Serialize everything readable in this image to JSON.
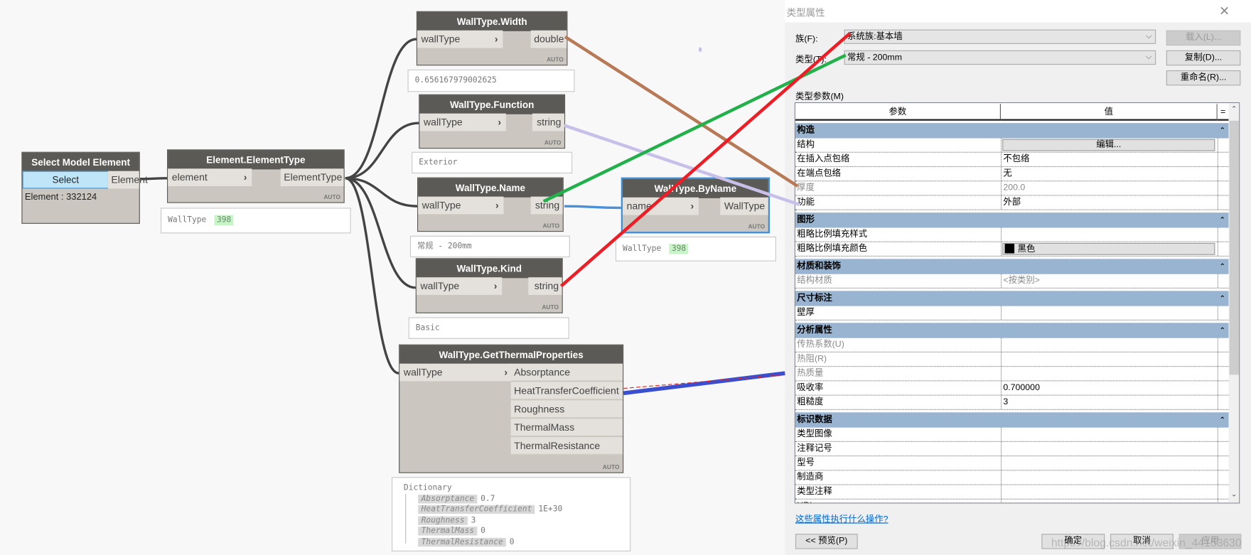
{
  "graph": {
    "nodes": [
      {
        "id": "select-model-element",
        "title": "Select Model Element",
        "button": "Select",
        "inputs": [],
        "outputs": [
          "Element"
        ],
        "info": "Element : 332124",
        "auto": ""
      },
      {
        "id": "element-elementtype",
        "title": "Element.ElementType",
        "inputs": [
          "element"
        ],
        "outputs": [
          "ElementType"
        ],
        "auto": "AUTO",
        "preview": {
          "type": "WallType",
          "badge": "398"
        }
      },
      {
        "id": "walltype-width",
        "title": "WallType.Width",
        "inputs": [
          "wallType"
        ],
        "outputs": [
          "double"
        ],
        "auto": "AUTO",
        "preview": {
          "text": "0.656167979002625"
        }
      },
      {
        "id": "walltype-function",
        "title": "WallType.Function",
        "inputs": [
          "wallType"
        ],
        "outputs": [
          "string"
        ],
        "auto": "AUTO",
        "preview": {
          "text": "Exterior"
        }
      },
      {
        "id": "walltype-name",
        "title": "WallType.Name",
        "inputs": [
          "wallType"
        ],
        "outputs": [
          "string"
        ],
        "auto": "AUTO",
        "preview": {
          "text": "常规 - 200mm"
        }
      },
      {
        "id": "walltype-kind",
        "title": "WallType.Kind",
        "inputs": [
          "wallType"
        ],
        "outputs": [
          "string"
        ],
        "auto": "AUTO",
        "preview": {
          "text": "Basic"
        }
      },
      {
        "id": "walltype-byname",
        "title": "WallType.ByName",
        "inputs": [
          "name"
        ],
        "outputs": [
          "WallType"
        ],
        "auto": "AUTO",
        "selected": true,
        "preview": {
          "type": "WallType",
          "badge": "398"
        }
      },
      {
        "id": "walltype-getthermalproperties",
        "title": "WallType.GetThermalProperties",
        "inputs": [
          "wallType"
        ],
        "outputs": [
          "Absorptance",
          "HeatTransferCoefficient",
          "Roughness",
          "ThermalMass",
          "ThermalResistance"
        ],
        "auto": "AUTO",
        "preview": {
          "dict_label": "Dictionary",
          "entries": [
            {
              "key": "Absorptance",
              "value": "0.7"
            },
            {
              "key": "HeatTransferCoefficient",
              "value": "1E+30"
            },
            {
              "key": "Roughness",
              "value": "3"
            },
            {
              "key": "ThermalMass",
              "value": "0"
            },
            {
              "key": "ThermalResistance",
              "value": "0"
            }
          ]
        }
      }
    ],
    "annotation_colors": {
      "width": "#b87a56",
      "function": "#c8c0e8",
      "name": "#22b04a",
      "kind": "#ee1c24",
      "thermal": "#3a4fd0"
    }
  },
  "dialog": {
    "title": "类型属性",
    "close_icon": "close-icon",
    "family_label": "族(F):",
    "family_value": "系统族:基本墙",
    "type_label": "类型(T):",
    "type_value": "常规 - 200mm",
    "load_button": "载入(L)...",
    "duplicate_button": "复制(D)...",
    "rename_button": "重命名(R)...",
    "params_label": "类型参数(M)",
    "col_param": "参数",
    "col_value": "值",
    "col_eq": "=",
    "groups": [
      {
        "name": "构造",
        "rows": [
          {
            "k": "结构",
            "v": "编辑...",
            "kind": "button"
          },
          {
            "k": "在插入点包络",
            "v": "不包络"
          },
          {
            "k": "在端点包络",
            "v": "无"
          },
          {
            "k": "厚度",
            "v": "200.0",
            "gray": true
          },
          {
            "k": "功能",
            "v": "外部"
          }
        ]
      },
      {
        "name": "图形",
        "rows": [
          {
            "k": "粗略比例填充样式",
            "v": ""
          },
          {
            "k": "粗略比例填充颜色",
            "v": "黑色",
            "kind": "color",
            "color": "#000000"
          }
        ]
      },
      {
        "name": "材质和装饰",
        "rows": [
          {
            "k": "结构材质",
            "v": "<按类别>",
            "gray": true
          }
        ]
      },
      {
        "name": "尺寸标注",
        "rows": [
          {
            "k": "壁厚",
            "v": ""
          }
        ]
      },
      {
        "name": "分析属性",
        "rows": [
          {
            "k": "传热系数(U)",
            "v": "",
            "gray": true
          },
          {
            "k": "热阻(R)",
            "v": "",
            "gray": true
          },
          {
            "k": "热质量",
            "v": "",
            "gray": true
          },
          {
            "k": "吸收率",
            "v": "0.700000"
          },
          {
            "k": "粗糙度",
            "v": "3"
          }
        ]
      },
      {
        "name": "标识数据",
        "rows": [
          {
            "k": "类型图像",
            "v": ""
          },
          {
            "k": "注释记号",
            "v": ""
          },
          {
            "k": "型号",
            "v": ""
          },
          {
            "k": "制造商",
            "v": ""
          },
          {
            "k": "类型注释",
            "v": ""
          },
          {
            "k": "URL",
            "v": ""
          }
        ]
      }
    ],
    "help_link": "这些属性执行什么操作?",
    "preview_button": "<< 预览(P)",
    "ok_button": "确定",
    "cancel_button": "取消",
    "apply_button": "应用",
    "watermark": "https://blog.csdn.net/weixin_44153630"
  }
}
